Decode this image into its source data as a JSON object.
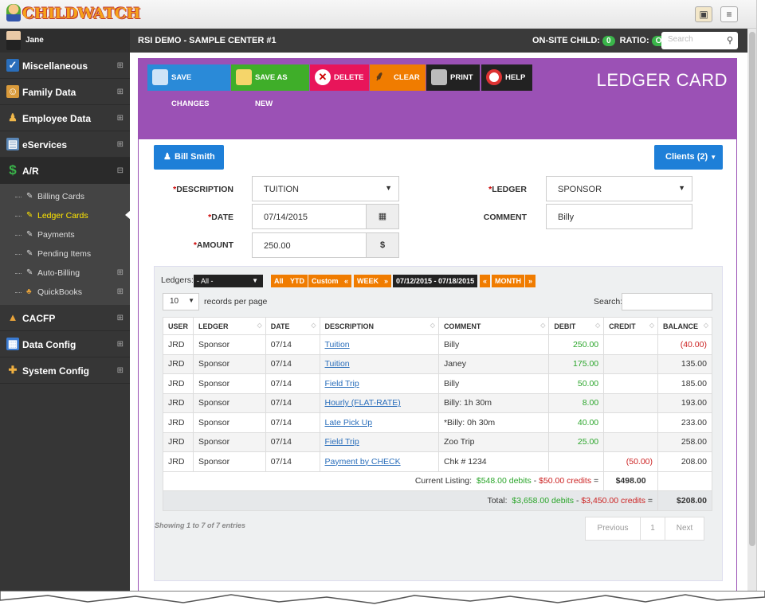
{
  "app": {
    "logo": "CHILDWATCH"
  },
  "header": {
    "user_name": "Jane",
    "center": "RSI DEMO - SAMPLE CENTER #1",
    "onsite_label": "ON-SITE CHILD:",
    "onsite_count": "0",
    "ratio_label": "RATIO:",
    "ratio_value": "OK",
    "search_placeholder": "Search"
  },
  "sidebar": {
    "items": [
      {
        "label": "Miscellaneous",
        "icon": "checklist-icon"
      },
      {
        "label": "Family Data",
        "icon": "family-icon"
      },
      {
        "label": "Employee Data",
        "icon": "employee-icon"
      },
      {
        "label": "eServices",
        "icon": "eservices-icon"
      },
      {
        "label": "A/R",
        "icon": "dollar-icon"
      }
    ],
    "ar_sub": [
      {
        "label": "Billing Cards"
      },
      {
        "label": "Ledger Cards"
      },
      {
        "label": "Payments"
      },
      {
        "label": "Pending Items"
      },
      {
        "label": "Auto-Billing"
      },
      {
        "label": "QuickBooks"
      }
    ],
    "items_after": [
      {
        "label": "CACFP",
        "icon": "cacfp-icon"
      },
      {
        "label": "Data Config",
        "icon": "data-config-icon"
      },
      {
        "label": "System Config",
        "icon": "wrench-icon"
      }
    ]
  },
  "toolbar": {
    "save_changes": "SAVE CHANGES",
    "save_as_new": "SAVE AS NEW",
    "delete": "DELETE",
    "clear": "CLEAR",
    "print": "PRINT",
    "help": "HELP",
    "colors": {
      "save": "#2a8ad8",
      "save_new": "#3fae29",
      "delete": "#e8155a",
      "clear": "#f07c00",
      "print": "#222222",
      "help": "#222222"
    }
  },
  "page_title": "LEDGER CARD",
  "client_button": "Bill Smith",
  "clients_dropdown": "Clients (2)",
  "form": {
    "description_label": "DESCRIPTION",
    "description_value": "TUITION",
    "ledger_label": "LEDGER",
    "ledger_value": "SPONSOR",
    "date_label": "DATE",
    "date_value": "07/14/2015",
    "comment_label": "COMMENT",
    "comment_value": "Billy",
    "amount_label": "AMOUNT",
    "amount_value": "250.00",
    "amount_addon": "$"
  },
  "filters": {
    "ledgers_label": "Ledgers:",
    "ledgers_value": "- All -",
    "all": "All",
    "ytd": "YTD",
    "custom": "Custom",
    "prev": "«",
    "week": "WEEK",
    "next": "»",
    "range": "07/12/2015 - 07/18/2015",
    "prev2": "«",
    "month": "MONTH",
    "next2": "»"
  },
  "records": {
    "count": "10",
    "label": "records per page",
    "search_label": "Search:"
  },
  "table": {
    "headers": [
      "USER",
      "LEDGER",
      "DATE",
      "DESCRIPTION",
      "COMMENT",
      "DEBIT",
      "CREDIT",
      "BALANCE"
    ],
    "rows": [
      {
        "user": "JRD",
        "ledger": "Sponsor",
        "date": "07/14",
        "description": "Tuition",
        "comment": "Billy",
        "debit": "250.00",
        "credit": "",
        "balance": "(40.00)"
      },
      {
        "user": "JRD",
        "ledger": "Sponsor",
        "date": "07/14",
        "description": "Tuition",
        "comment": "Janey",
        "debit": "175.00",
        "credit": "",
        "balance": "135.00"
      },
      {
        "user": "JRD",
        "ledger": "Sponsor",
        "date": "07/14",
        "description": "Field Trip",
        "comment": "Billy",
        "debit": "50.00",
        "credit": "",
        "balance": "185.00"
      },
      {
        "user": "JRD",
        "ledger": "Sponsor",
        "date": "07/14",
        "description": "Hourly (FLAT-RATE)",
        "comment": "Billy: 1h 30m",
        "debit": "8.00",
        "credit": "",
        "balance": "193.00"
      },
      {
        "user": "JRD",
        "ledger": "Sponsor",
        "date": "07/14",
        "description": "Late Pick Up",
        "comment": "*Billy: 0h 30m",
        "debit": "40.00",
        "credit": "",
        "balance": "233.00"
      },
      {
        "user": "JRD",
        "ledger": "Sponsor",
        "date": "07/14",
        "description": "Field Trip",
        "comment": "Zoo Trip",
        "debit": "25.00",
        "credit": "",
        "balance": "258.00"
      },
      {
        "user": "JRD",
        "ledger": "Sponsor",
        "date": "07/14",
        "description": "Payment by CHECK",
        "comment": "Chk # 1234",
        "debit": "",
        "credit": "(50.00)",
        "balance": "208.00"
      }
    ],
    "current_label": "Current Listing:",
    "current_debits": "$548.00 debits",
    "current_credits": "$50.00 credits",
    "current_total": "$498.00",
    "total_label": "Total:",
    "total_debits": "$3,658.00 debits",
    "total_credits": "$3,450.00 credits",
    "total_total": "$208.00"
  },
  "footer": {
    "showing": "Showing 1 to 7 of 7 entries",
    "previous": "Previous",
    "page": "1",
    "next": "Next"
  }
}
